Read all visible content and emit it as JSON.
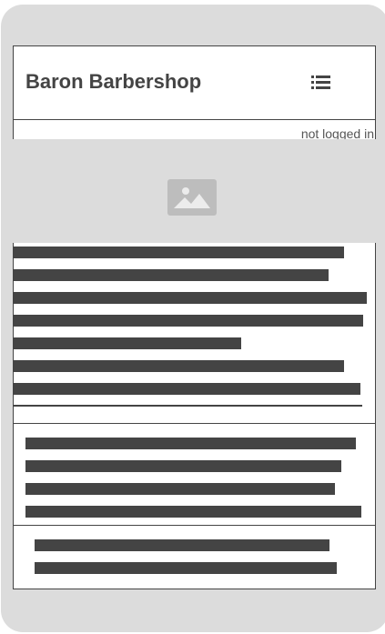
{
  "header": {
    "brand": "Baron Barbershop",
    "menu_icon": "list-menu-icon"
  },
  "login_status": "not logged in",
  "hero": {
    "icon": "image-placeholder-icon"
  },
  "colors": {
    "frame": "#dcdcdc",
    "text_block": "#444444",
    "screen": "#ffffff"
  }
}
